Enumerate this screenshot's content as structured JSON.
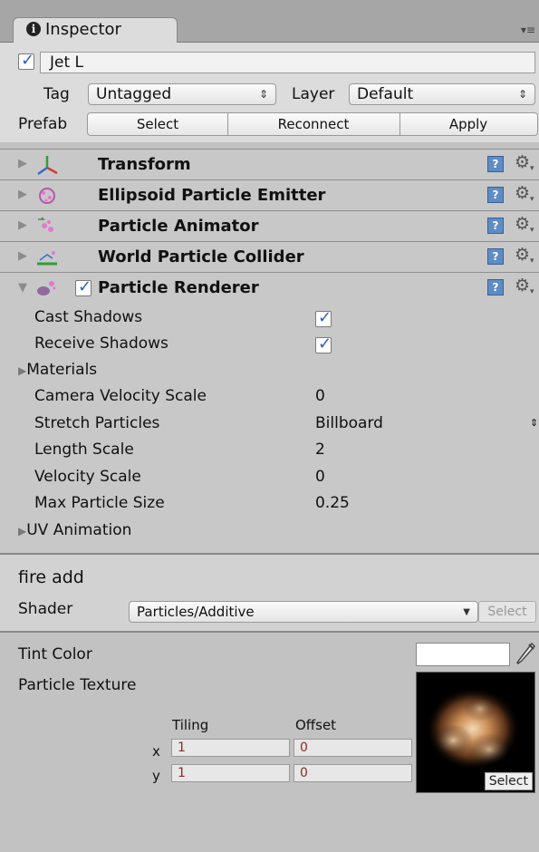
{
  "tab": {
    "label": "Inspector",
    "info_icon": "i",
    "menu_icon": "▾≡"
  },
  "object": {
    "name": "Jet L",
    "active": true
  },
  "tag": {
    "label": "Tag",
    "value": "Untagged"
  },
  "layer": {
    "label": "Layer",
    "value": "Default"
  },
  "prefab": {
    "label": "Prefab",
    "select": "Select",
    "reconnect": "Reconnect",
    "apply": "Apply"
  },
  "components": [
    {
      "title": "Transform",
      "icon": "transform-axes-icon"
    },
    {
      "title": "Ellipsoid Particle Emitter",
      "icon": "emitter-icon"
    },
    {
      "title": "Particle Animator",
      "icon": "animator-icon"
    },
    {
      "title": "World Particle Collider",
      "icon": "collider-icon"
    },
    {
      "title": "Particle Renderer",
      "icon": "renderer-icon",
      "enabled": true
    }
  ],
  "help_icon": "?",
  "renderer": {
    "cast_shadows": {
      "label": "Cast Shadows",
      "checked": true
    },
    "receive_shadows": {
      "label": "Receive Shadows",
      "checked": true
    },
    "materials": "Materials",
    "camera_velocity_scale": {
      "label": "Camera Velocity Scale",
      "value": "0"
    },
    "stretch_particles": {
      "label": "Stretch Particles",
      "value": "Billboard"
    },
    "length_scale": {
      "label": "Length Scale",
      "value": "2"
    },
    "velocity_scale": {
      "label": "Velocity Scale",
      "value": "0"
    },
    "max_particle_size": {
      "label": "Max Particle Size",
      "value": "0.25"
    },
    "uv_animation": "UV Animation"
  },
  "material": {
    "name": "fire add",
    "shader_label": "Shader",
    "shader_value": "Particles/Additive",
    "shader_select": "Select"
  },
  "material_props": {
    "tint_color": "Tint Color",
    "particle_texture": "Particle Texture",
    "tiling": "Tiling",
    "offset": "Offset",
    "x_label": "x",
    "y_label": "y",
    "tiling_x": "1",
    "tiling_y": "1",
    "offset_x": "0",
    "offset_y": "0",
    "texture_select": "Select"
  }
}
